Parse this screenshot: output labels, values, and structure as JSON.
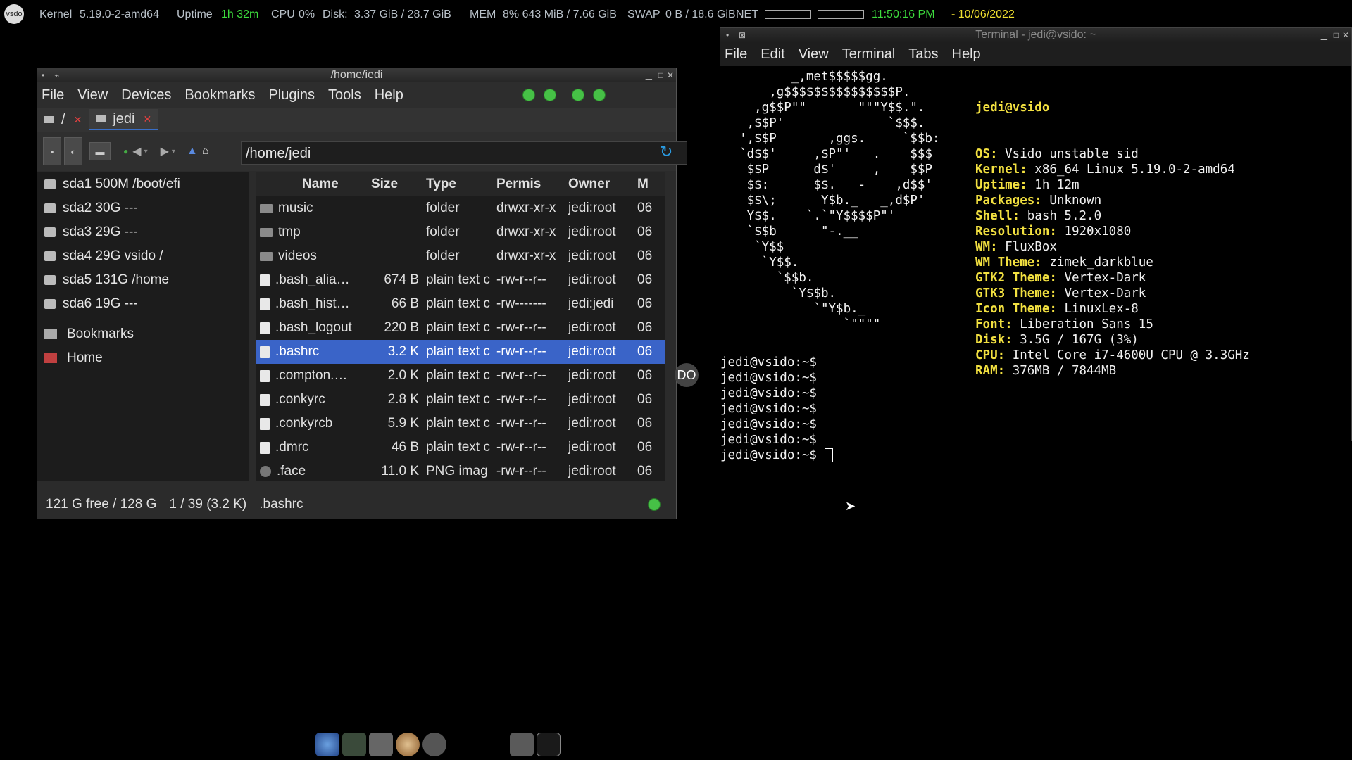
{
  "conky": {
    "logo_text": "vsdo",
    "kernel_label": "Kernel",
    "kernel": "5.19.0-2-amd64",
    "uptime_label": "Uptime",
    "uptime": "1h 32m",
    "cpu_label": "CPU",
    "cpu": "0%",
    "disk_label": "Disk:",
    "disk": "3.37 GiB / 28.7 GiB",
    "mem_label": "MEM",
    "mem": "8% 643 MiB / 7.66 GiB",
    "swap_label": "SWAP",
    "swap": "0 B / 18.6 GiB",
    "net_label": "NET",
    "time": "11:50:16 PM",
    "date": "- 10/06/2022"
  },
  "file_manager": {
    "title": "/home/iedi",
    "menu": [
      "File",
      "View",
      "Devices",
      "Bookmarks",
      "Plugins",
      "Tools",
      "Help"
    ],
    "tabs": [
      {
        "label": "/"
      },
      {
        "label": "jedi"
      }
    ],
    "path": "/home/jedi",
    "devices": [
      {
        "label": "sda1 500M /boot/efi"
      },
      {
        "label": "sda2 30G ---"
      },
      {
        "label": "sda3 29G ---"
      },
      {
        "label": "sda4 29G vsido /"
      },
      {
        "label": "sda5 131G /home"
      },
      {
        "label": "sda6 19G ---"
      }
    ],
    "bookmarks": [
      {
        "label": "Bookmarks"
      },
      {
        "label": "Home"
      }
    ],
    "columns": [
      "Name",
      "Size",
      "Type",
      "Permis",
      "Owner",
      "M"
    ],
    "files": [
      {
        "name": "music",
        "size": "",
        "type": "folder",
        "perm": "drwxr-xr-x",
        "owner": "jedi:root",
        "mod": "06",
        "kind": "folder"
      },
      {
        "name": "tmp",
        "size": "",
        "type": "folder",
        "perm": "drwxr-xr-x",
        "owner": "jedi:root",
        "mod": "06",
        "kind": "folder"
      },
      {
        "name": "videos",
        "size": "",
        "type": "folder",
        "perm": "drwxr-xr-x",
        "owner": "jedi:root",
        "mod": "06",
        "kind": "folder"
      },
      {
        "name": ".bash_alia…",
        "size": "674 B",
        "type": "plain text c",
        "perm": "-rw-r--r--",
        "owner": "jedi:root",
        "mod": "06",
        "kind": "file"
      },
      {
        "name": ".bash_hist…",
        "size": "66 B",
        "type": "plain text c",
        "perm": "-rw-------",
        "owner": "jedi:jedi",
        "mod": "06",
        "kind": "file"
      },
      {
        "name": ".bash_logout",
        "size": "220 B",
        "type": "plain text c",
        "perm": "-rw-r--r--",
        "owner": "jedi:root",
        "mod": "06",
        "kind": "file"
      },
      {
        "name": ".bashrc",
        "size": "3.2 K",
        "type": "plain text c",
        "perm": "-rw-r--r--",
        "owner": "jedi:root",
        "mod": "06",
        "kind": "file",
        "selected": true
      },
      {
        "name": ".compton.…",
        "size": "2.0 K",
        "type": "plain text c",
        "perm": "-rw-r--r--",
        "owner": "jedi:root",
        "mod": "06",
        "kind": "file"
      },
      {
        "name": ".conkyrc",
        "size": "2.8 K",
        "type": "plain text c",
        "perm": "-rw-r--r--",
        "owner": "jedi:root",
        "mod": "06",
        "kind": "file"
      },
      {
        "name": ".conkyrcb",
        "size": "5.9 K",
        "type": "plain text c",
        "perm": "-rw-r--r--",
        "owner": "jedi:root",
        "mod": "06",
        "kind": "file"
      },
      {
        "name": ".dmrc",
        "size": "46 B",
        "type": "plain text c",
        "perm": "-rw-r--r--",
        "owner": "jedi:root",
        "mod": "06",
        "kind": "file"
      },
      {
        "name": ".face",
        "size": "11.0 K",
        "type": "PNG imag",
        "perm": "-rw-r--r--",
        "owner": "jedi:root",
        "mod": "06",
        "kind": "png"
      }
    ],
    "status": {
      "free": "121 G free / 128 G",
      "selection": "1 / 39 (3.2 K)",
      "selected_name": ".bashrc"
    }
  },
  "terminal": {
    "title": "Terminal - jedi@vsido: ~",
    "menu": [
      "File",
      "Edit",
      "View",
      "Terminal",
      "Tabs",
      "Help"
    ],
    "ascii_art": "         _,met$$$$$gg.\n      ,g$$$$$$$$$$$$$$$P.\n    ,g$$P\"\"       \"\"\"Y$$.\".\n   ,$$P'              `$$$.\n  ',$$P       ,ggs.     `$$b:\n  `d$$'     ,$P\"'   .    $$$\n   $$P      d$'     ,    $$P\n   $$:      $$.   -    ,d$$'\n   $$\\;      Y$b._   _,d$P'\n   Y$$.    `.`\"Y$$$$P\"'\n   `$$b      \"-.__\n    `Y$$\n     `Y$$.\n       `$$b.\n         `Y$$b.\n            `\"Y$b._\n                `\"\"\"\"",
    "user_host": "jedi@vsido",
    "info": [
      {
        "key": "OS:",
        "value": " Vsido unstable sid"
      },
      {
        "key": "Kernel:",
        "value": " x86_64 Linux 5.19.0-2-amd64"
      },
      {
        "key": "Uptime:",
        "value": " 1h 12m"
      },
      {
        "key": "Packages:",
        "value": " Unknown"
      },
      {
        "key": "Shell:",
        "value": " bash 5.2.0"
      },
      {
        "key": "Resolution:",
        "value": " 1920x1080"
      },
      {
        "key": "WM:",
        "value": " FluxBox"
      },
      {
        "key": "WM Theme:",
        "value": " zimek_darkblue"
      },
      {
        "key": "GTK2 Theme:",
        "value": " Vertex-Dark"
      },
      {
        "key": "GTK3 Theme:",
        "value": " Vertex-Dark"
      },
      {
        "key": "Icon Theme:",
        "value": " LinuxLex-8"
      },
      {
        "key": "Font:",
        "value": " Liberation Sans 15"
      },
      {
        "key": "Disk:",
        "value": " 3.5G / 167G (3%)"
      },
      {
        "key": "CPU:",
        "value": " Intel Core i7-4600U CPU @ 3.3GHz"
      },
      {
        "key": "RAM:",
        "value": " 376MB / 7844MB"
      }
    ],
    "prompts": [
      "jedi@vsido:~$",
      "jedi@vsido:~$",
      "jedi@vsido:~$",
      "jedi@vsido:~$",
      "jedi@vsido:~$",
      "jedi@vsido:~$",
      "jedi@vsido:~$ "
    ]
  },
  "desktop": {
    "badge_text": "DO"
  },
  "colors": {
    "selection": "#3a64c8",
    "accent_green": "#3ddc3d",
    "accent_yellow": "#f0e030"
  }
}
